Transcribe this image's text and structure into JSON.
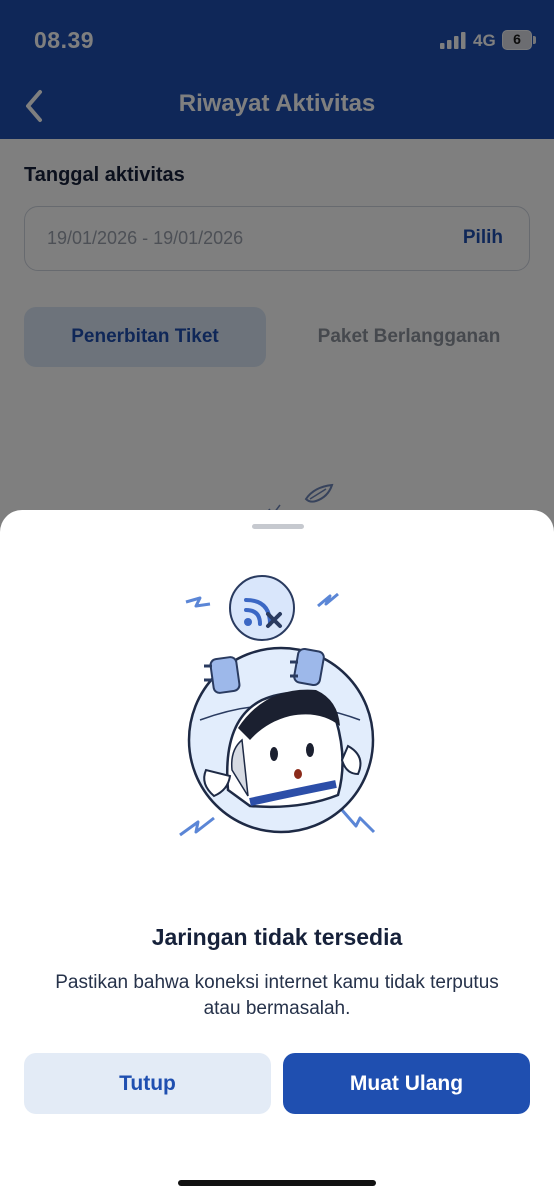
{
  "status_bar": {
    "time": "08.39",
    "network": "4G",
    "battery_level": "6"
  },
  "header": {
    "title": "Riwayat Aktivitas",
    "back_icon": "chevron-left-icon"
  },
  "filter": {
    "label": "Tanggal aktivitas",
    "date_range": "19/01/2026 - 19/01/2026",
    "pick_label": "Pilih"
  },
  "tabs": [
    {
      "label": "Penerbitan Tiket",
      "active": true
    },
    {
      "label": "Paket Berlangganan",
      "active": false
    }
  ],
  "sheet": {
    "illustration_icon": "no-network-mascot-illustration",
    "title": "Jaringan tidak tersedia",
    "message": "Pastikan bahwa koneksi internet kamu tidak terputus atau bermasalah.",
    "close_label": "Tutup",
    "reload_label": "Muat Ulang"
  },
  "colors": {
    "primary": "#1f4fb0",
    "secondary_button_bg": "#e3ebf6",
    "text_dark": "#16213a"
  }
}
